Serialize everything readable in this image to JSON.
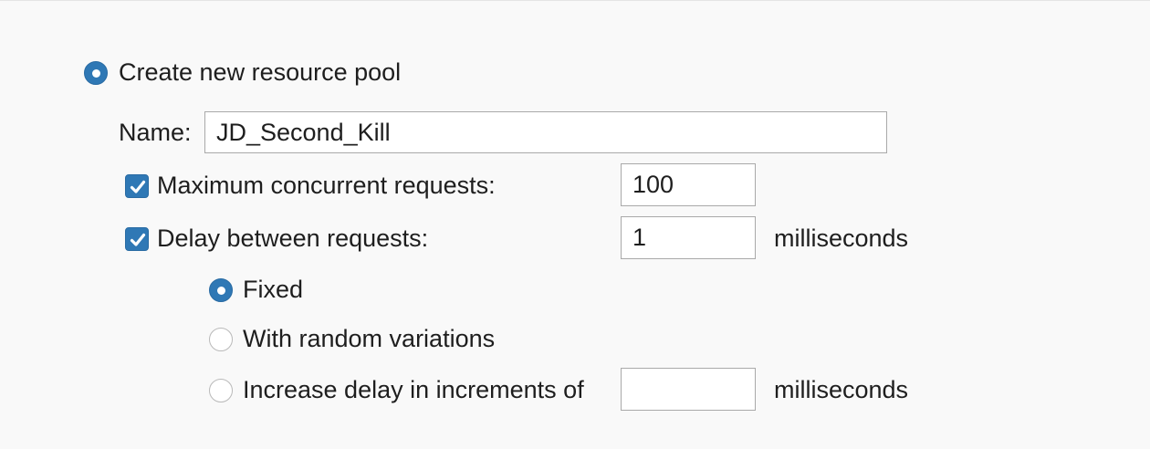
{
  "pool": {
    "create_label": "Create new resource pool",
    "create_selected": true,
    "name_label": "Name:",
    "name_value": "JD_Second_Kill",
    "max_concurrent": {
      "label": "Maximum concurrent requests:",
      "checked": true,
      "value": "100"
    },
    "delay": {
      "label": "Delay between requests:",
      "checked": true,
      "value": "1",
      "unit": "milliseconds"
    },
    "delay_modes": {
      "fixed_label": "Fixed",
      "random_label": "With random variations",
      "increase_label": "Increase delay in increments of",
      "increase_value": "",
      "increase_unit": "milliseconds",
      "selected": "fixed"
    }
  },
  "colors": {
    "accent": "#2f78b5",
    "background": "#f9f9f9",
    "field_border": "#a9a9a9",
    "text": "#1e1e1e"
  }
}
